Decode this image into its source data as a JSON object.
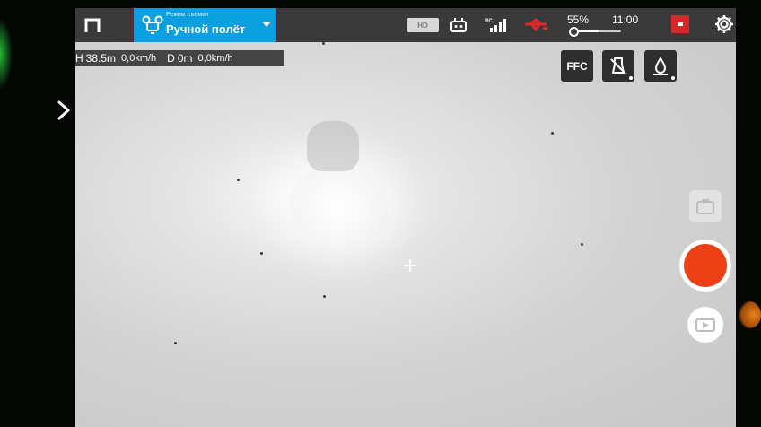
{
  "mode": {
    "subtitle": "Режим съемки",
    "title": "Ручной полёт"
  },
  "status": {
    "video_quality": "HD",
    "battery_percent": "55%",
    "battery_level": 0.55,
    "time": "11:00"
  },
  "telemetry": {
    "height_label": "H",
    "height_value": "38.5m",
    "vertical_speed": "0,0km/h",
    "distance_label": "D",
    "distance_value": "0m",
    "horizontal_speed": "0,0km/h"
  },
  "actions": {
    "ffc_label": "FFC"
  },
  "colors": {
    "mode_panel": "#0aa0e0",
    "top_bar": "#3a3a3a",
    "shutter": "#ec3f14",
    "record_indicator": "#d62a2a"
  },
  "icons": {
    "home": "home-icon",
    "mode": "drone-mode-icon",
    "remote": "remote-controller-icon",
    "signal": "rc-signal-icon",
    "drone_status": "drone-warning-icon",
    "record": "record-indicator-icon",
    "settings": "gear-icon",
    "side_arrow": "chevron-right-icon",
    "thermal_palette": "thermal-palette-icon",
    "thermal_mode": "thermal-drop-icon",
    "camera_mode": "camera-switch-icon",
    "playback": "playback-icon"
  }
}
